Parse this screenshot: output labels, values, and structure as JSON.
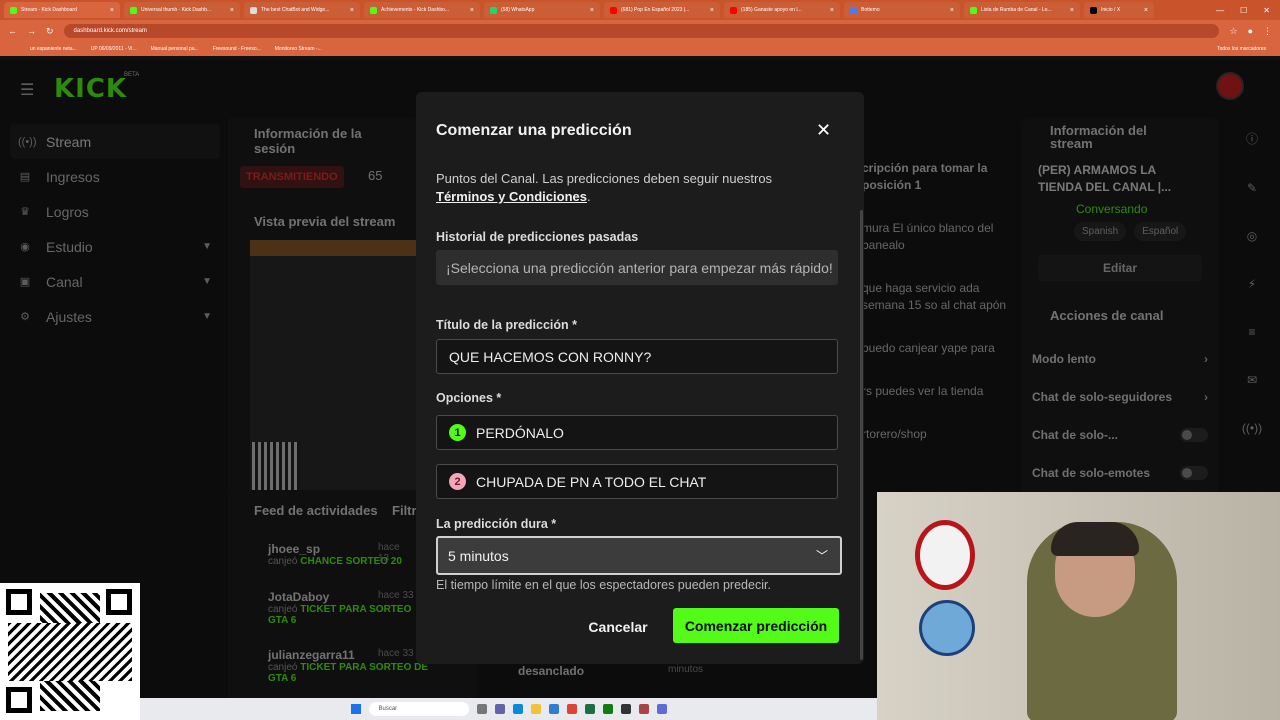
{
  "browser": {
    "tabs": [
      {
        "label": "Stream - Kick Dashboard",
        "active": true
      },
      {
        "label": "Universal thumb - Kick Dashb..."
      },
      {
        "label": "The best ChatBot and Widge..."
      },
      {
        "label": "Achievements - Kick Dashbo..."
      },
      {
        "label": "(58) WhatsApp"
      },
      {
        "label": "(681) Pop En Español 2023 |..."
      },
      {
        "label": "(185) Ganaste apoyo en l..."
      },
      {
        "label": "Bottemo"
      },
      {
        "label": "Lista de Rumba de Canal - Lo..."
      },
      {
        "label": "Inicio / X"
      }
    ],
    "url": "dashboard.kick.com/stream",
    "bookmarks": [
      "un espaniente neta...",
      "UP 06/09/2011 - Vi...",
      "Manual personal pa...",
      "Freesound - Freeso...",
      "Monitoreo Stream -..."
    ],
    "bookmarks_right": "Todos los marcadores"
  },
  "app": {
    "logo": "KICK",
    "logo_beta": "BETA",
    "sidebar": [
      {
        "label": "Stream",
        "icon": "stream-icon",
        "active": true
      },
      {
        "label": "Ingresos",
        "icon": "revenue-icon"
      },
      {
        "label": "Logros",
        "icon": "trophy-icon"
      },
      {
        "label": "Estudio",
        "icon": "studio-icon",
        "chevron": true
      },
      {
        "label": "Canal",
        "icon": "channel-icon",
        "chevron": true
      },
      {
        "label": "Ajustes",
        "icon": "gear-icon",
        "chevron": true
      }
    ],
    "session_title": "Información de la sesión",
    "live_badge": "TRANSMITIENDO",
    "viewers": "65",
    "preview_title": "Vista previa del stream",
    "feed_title": "Feed de actividades",
    "feed_filter": "Filtr",
    "feed": [
      {
        "name": "jhoee_sp",
        "time": "hace 13",
        "action": "canjeó",
        "reward": "CHANCE SORTEO 20"
      },
      {
        "name": "JotaDaboy",
        "time": "hace 33",
        "action": "canjeó",
        "reward": "TICKET PARA SORTEO GTA 6"
      },
      {
        "name": "julianzegarra11",
        "time": "hace 33",
        "action": "canjeó",
        "reward": "TICKET PARA SORTEO DE GTA 6"
      }
    ],
    "feed_extra": "desanclado",
    "feed_extra_time": "minutos",
    "chat_snippets": [
      "cripción para tomar la posición 1",
      "mura El único blanco del banealo",
      "que haga servicio ada semana 15 so al chat apón",
      "puedo canjear yape para",
      "rs puedes ver la tienda",
      "rtorero/shop"
    ],
    "stream_info": {
      "title": "Información del stream",
      "stream_name": "(PER) ARMAMOS LA TIENDA DEL CANAL |...",
      "category": "Conversando",
      "tags": [
        "Spanish",
        "Español"
      ],
      "edit_label": "Editar"
    },
    "channel_actions": {
      "title": "Acciones de canal",
      "items": [
        {
          "label": "Modo lento",
          "type": "chevron"
        },
        {
          "label": "Chat de solo-seguidores",
          "type": "chevron"
        },
        {
          "label": "Chat de solo-...",
          "type": "toggle"
        },
        {
          "label": "Chat de solo-emotes",
          "type": "toggle"
        }
      ]
    }
  },
  "modal": {
    "title": "Comenzar una predicción",
    "intro_text": "Puntos del Canal. Las predicciones deben seguir nuestros",
    "terms_link": "Términos y Condiciones",
    "intro_end": ".",
    "history_label": "Historial de predicciones pasadas",
    "history_placeholder": "¡Selecciona una predicción anterior para empezar más rápido!",
    "title_label": "Título de la predicción *",
    "title_value": "QUE HACEMOS CON RONNY?",
    "options_label": "Opciones *",
    "options": [
      {
        "number": "1",
        "value": "PERDÓNALO"
      },
      {
        "number": "2",
        "value": "CHUPADA DE PN A TODO EL CHAT"
      }
    ],
    "duration_label": "La predicción dura *",
    "duration_value": "5 minutos",
    "duration_help": "El tiempo límite en el que los espectadores pueden predecir.",
    "cancel_label": "Cancelar",
    "submit_label": "Comenzar predicción"
  },
  "taskbar": {
    "search": "Buscar"
  },
  "colors": {
    "accent": "#53fc18",
    "browser_chrome": "#d8653d",
    "live": "#e0342a"
  }
}
